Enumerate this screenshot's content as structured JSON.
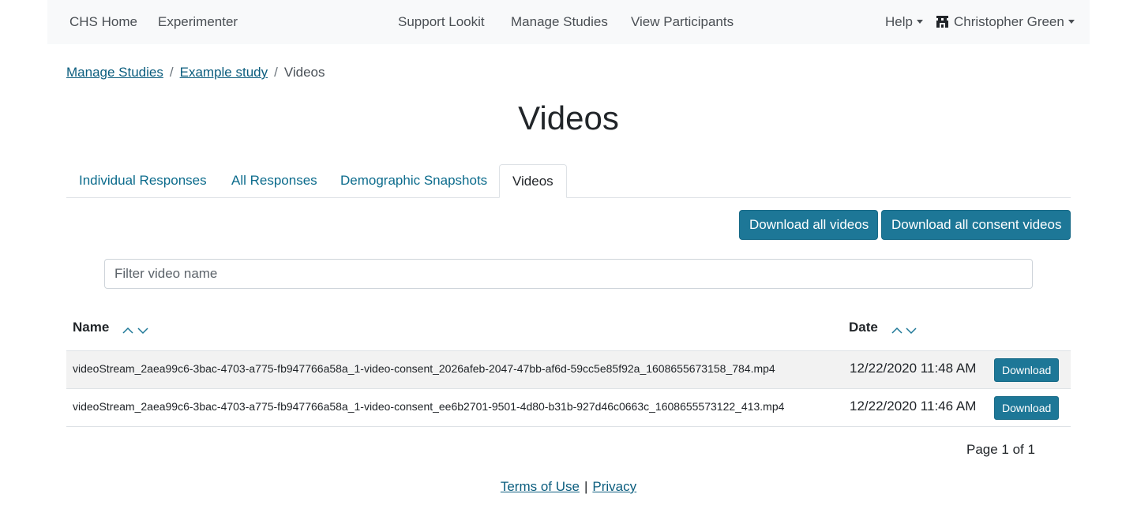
{
  "navbar": {
    "left_links": [
      "CHS Home",
      "Experimenter"
    ],
    "center_links": [
      "Support Lookit",
      "Manage Studies",
      "View Participants"
    ],
    "help_label": "Help",
    "user_name": "Christopher Green",
    "user_icon": "user-glyph-icon"
  },
  "breadcrumb": {
    "items": [
      "Manage Studies",
      "Example study"
    ],
    "current": "Videos",
    "separator": "/"
  },
  "page": {
    "title": "Videos"
  },
  "tabs": [
    {
      "label": "Individual Responses",
      "active": false
    },
    {
      "label": "All Responses",
      "active": false
    },
    {
      "label": "Demographic Snapshots",
      "active": false
    },
    {
      "label": "Videos",
      "active": true
    }
  ],
  "actions": {
    "download_all": "Download all videos",
    "download_consent": "Download all consent videos"
  },
  "filter": {
    "placeholder": "Filter video name",
    "value": ""
  },
  "table": {
    "columns": [
      "Name",
      "Date"
    ],
    "rows": [
      {
        "name": "videoStream_2aea99c6-3bac-4703-a775-fb947766a58a_1-video-consent_2026afeb-2047-47bb-af6d-59cc5e85f92a_1608655673158_784.mp4",
        "date": "12/22/2020 11:48 AM",
        "action": "Download"
      },
      {
        "name": "videoStream_2aea99c6-3bac-4703-a775-fb947766a58a_1-video-consent_ee6b2701-9501-4d80-b31b-927d46c0663c_1608655573122_413.mp4",
        "date": "12/22/2020 11:46 AM",
        "action": "Download"
      }
    ]
  },
  "pagination": {
    "text": "Page 1 of 1"
  },
  "footer": {
    "links": [
      "Terms of Use",
      "Privacy"
    ],
    "separator": "|"
  },
  "colors": {
    "primary": "#1d7797",
    "link": "#0b5d7e",
    "tab_link": "#0b6b8c",
    "navbar_bg": "#f8f9fa"
  }
}
